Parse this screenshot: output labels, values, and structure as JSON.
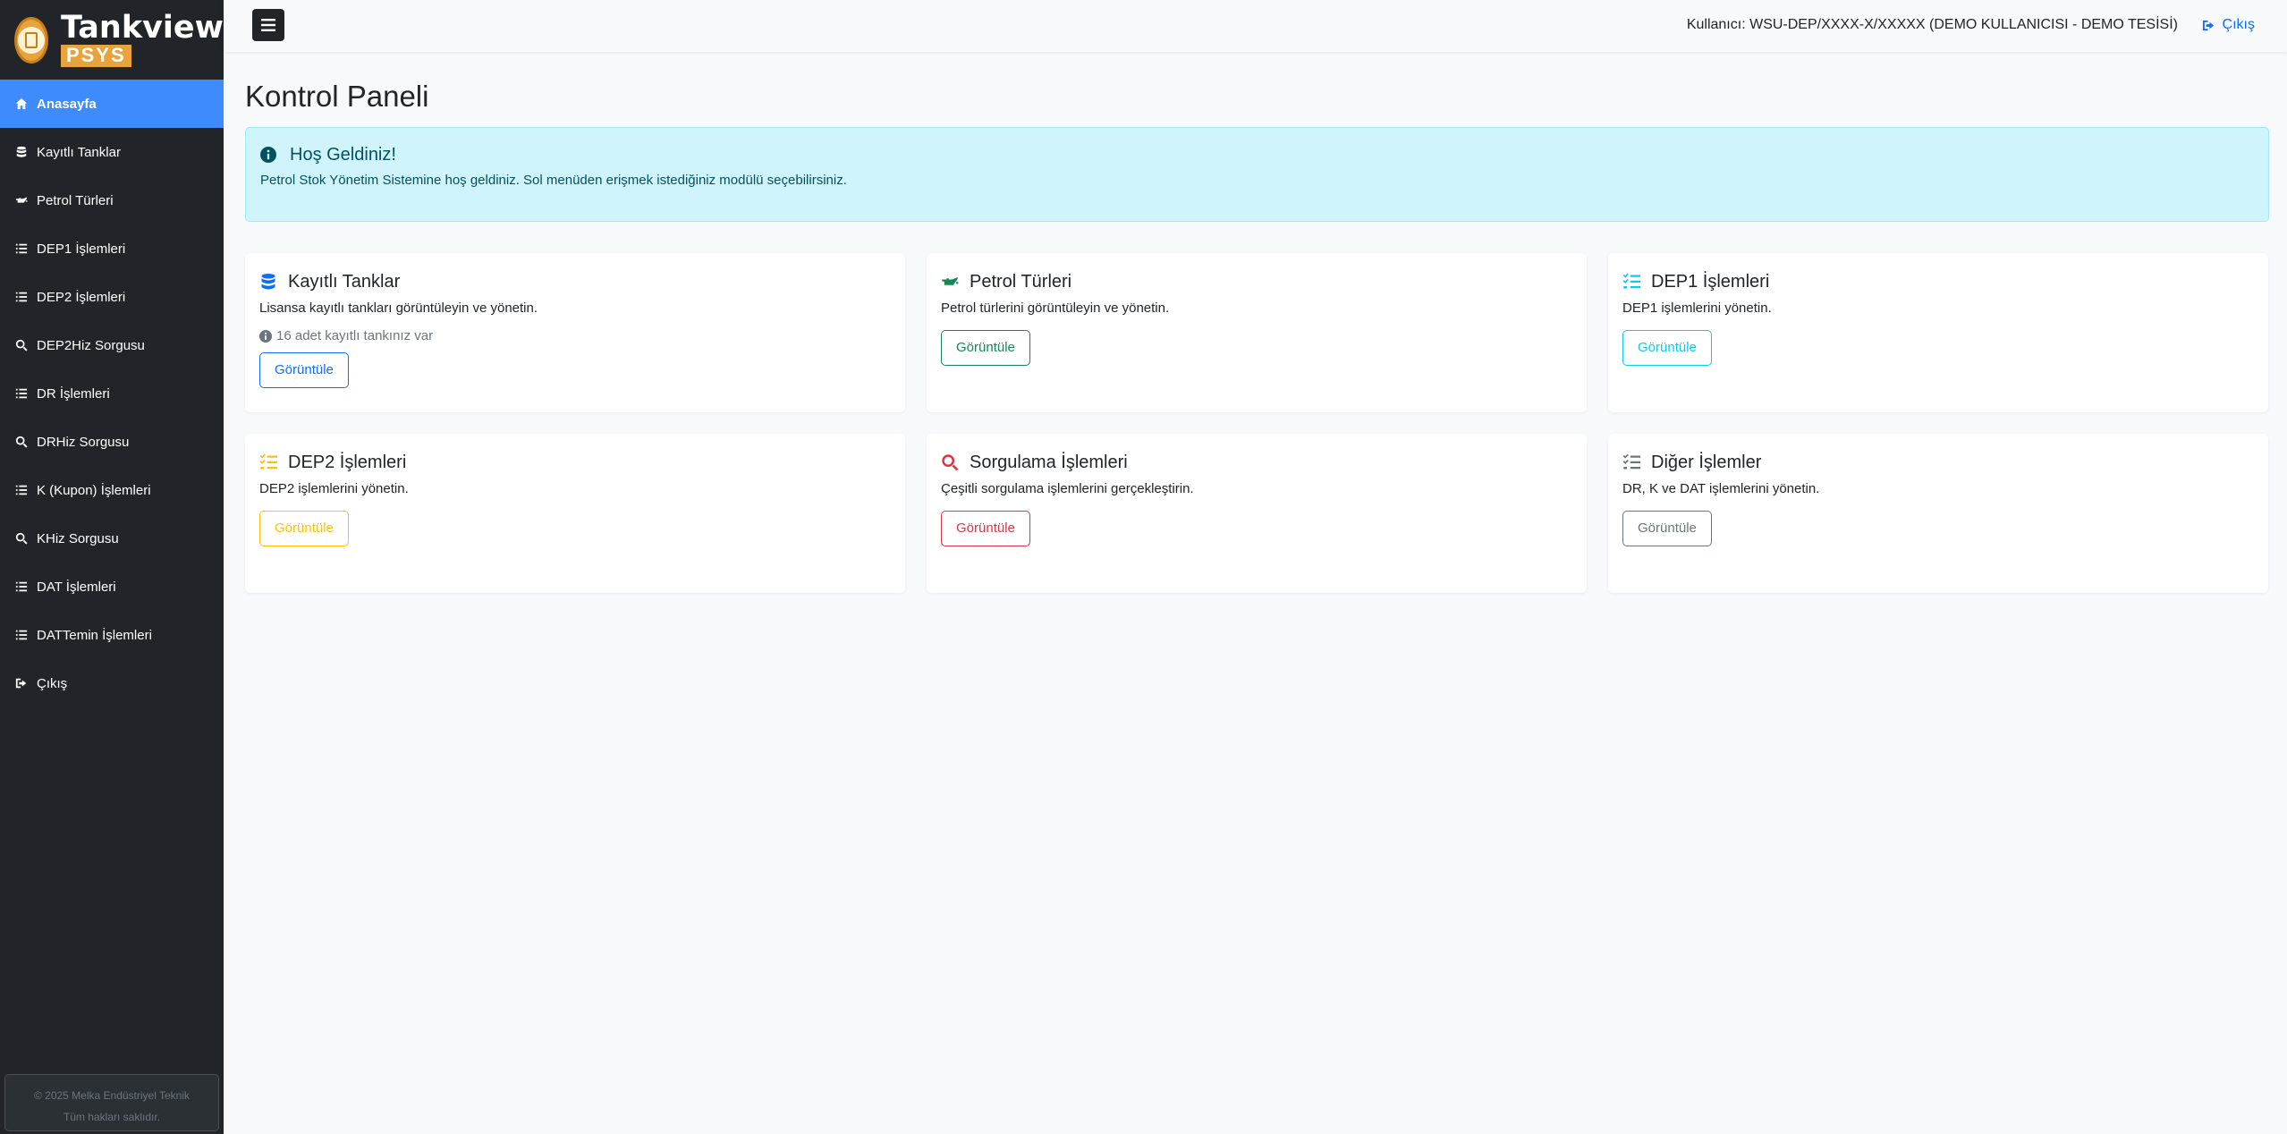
{
  "brand": {
    "name": "Tankview",
    "sub": "PSYS"
  },
  "sidebar": {
    "items": [
      {
        "label": "Anasayfa",
        "icon": "home-icon",
        "active": true
      },
      {
        "label": "Kayıtlı Tanklar",
        "icon": "database-icon"
      },
      {
        "label": "Petrol Türleri",
        "icon": "oil-can-icon"
      },
      {
        "label": "DEP1 İşlemleri",
        "icon": "list-icon"
      },
      {
        "label": "DEP2 İşlemleri",
        "icon": "list-icon"
      },
      {
        "label": "DEP2Hiz Sorgusu",
        "icon": "search-icon"
      },
      {
        "label": "DR İşlemleri",
        "icon": "list-icon"
      },
      {
        "label": "DRHiz Sorgusu",
        "icon": "search-icon"
      },
      {
        "label": "K (Kupon) İşlemleri",
        "icon": "list-icon"
      },
      {
        "label": "KHiz Sorgusu",
        "icon": "search-icon"
      },
      {
        "label": "DAT İşlemleri",
        "icon": "list-icon"
      },
      {
        "label": "DATTemin İşlemleri",
        "icon": "list-icon"
      },
      {
        "label": "Çıkış",
        "icon": "sign-out-icon"
      }
    ],
    "footer": {
      "copyright": "© 2025 Melka Endüstriyel Teknik",
      "rights": "Tüm hakları saklıdır."
    }
  },
  "topbar": {
    "user": "Kullanıcı: WSU-DEP/XXXX-X/XXXXX (DEMO KULLANICISI - DEMO TESİSİ)",
    "logout": "Çıkış"
  },
  "main": {
    "title": "Kontrol Paneli",
    "alert": {
      "title": "Hoş Geldiniz!",
      "text": "Petrol Stok Yönetim Sistemine hoş geldiniz. Sol menüden erişmek istediğiniz modülü seçebilirsiniz."
    },
    "cards": [
      {
        "title": "Kayıtlı Tanklar",
        "desc": "Lisansa kayıtlı tankları görüntüleyin ve yönetin.",
        "note": "16 adet kayıtlı tankınız var",
        "button": "Görüntüle",
        "color": "#0d6efd",
        "icon": "database-icon"
      },
      {
        "title": "Petrol Türleri",
        "desc": "Petrol türlerini görüntüleyin ve yönetin.",
        "button": "Görüntüle",
        "color": "#198754",
        "icon": "oil-can-icon"
      },
      {
        "title": "DEP1 İşlemleri",
        "desc": "DEP1 işlemlerini yönetin.",
        "button": "Görüntüle",
        "color": "#0dcaf0",
        "icon": "list-check-icon"
      },
      {
        "title": "DEP2 İşlemleri",
        "desc": "DEP2 işlemlerini yönetin.",
        "button": "Görüntüle",
        "color": "#ffc107",
        "icon": "list-check-icon"
      },
      {
        "title": "Sorgulama İşlemleri",
        "desc": "Çeşitli sorgulama işlemlerini gerçekleştirin.",
        "button": "Görüntüle",
        "color": "#dc3545",
        "icon": "search-icon"
      },
      {
        "title": "Diğer İşlemler",
        "desc": "DR, K ve DAT işlemlerini yönetin.",
        "button": "Görüntüle",
        "color": "#6c757d",
        "icon": "list-check-icon"
      }
    ]
  }
}
